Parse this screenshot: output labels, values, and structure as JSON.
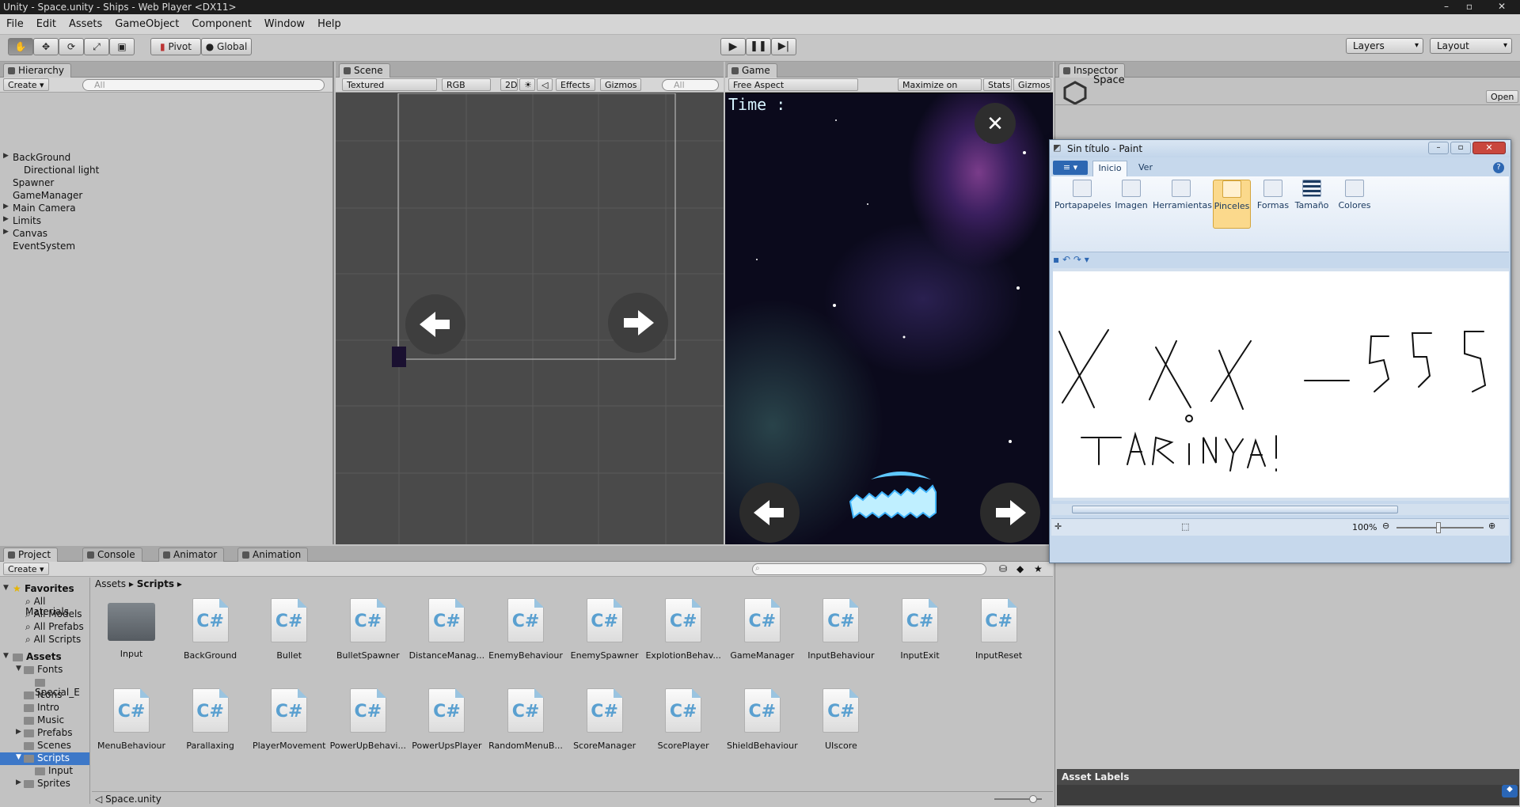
{
  "window": {
    "title": "Unity - Space.unity - Ships - Web Player <DX11>"
  },
  "menu": [
    "File",
    "Edit",
    "Assets",
    "GameObject",
    "Component",
    "Window",
    "Help"
  ],
  "toolbar": {
    "pivot": "Pivot",
    "global": "Global",
    "layers": "Layers",
    "layout": "Layout"
  },
  "hierarchy": {
    "tab": "Hierarchy",
    "create": "Create",
    "search_placeholder": "All",
    "items": [
      "BackGround",
      "Directional light",
      "Spawner",
      "GameManager",
      "Main Camera",
      "Limits",
      "Canvas",
      "EventSystem"
    ]
  },
  "scene": {
    "tab": "Scene",
    "shading": "Textured",
    "render": "RGB",
    "mode2d": "2D",
    "effects": "Effects",
    "gizmos": "Gizmos",
    "search_placeholder": "All"
  },
  "game": {
    "tab": "Game",
    "aspect": "Free Aspect",
    "maximize": "Maximize on Play",
    "stats": "Stats",
    "gizmos": "Gizmos",
    "time_label": "Time :"
  },
  "inspector": {
    "tab": "Inspector",
    "object": "Space",
    "open": "Open",
    "asset_labels": "Asset Labels"
  },
  "project": {
    "tabs": [
      "Project",
      "Console",
      "Animator",
      "Animation"
    ],
    "create": "Create",
    "breadcrumb": [
      "Assets",
      "Scripts"
    ],
    "favorites": {
      "title": "Favorites",
      "items": [
        "All Materials",
        "All Models",
        "All Prefabs",
        "All Scripts"
      ]
    },
    "assets_tree": {
      "title": "Assets",
      "items": [
        "Fonts",
        "Special_E",
        "Icons",
        "Intro",
        "Music",
        "Prefabs",
        "Scenes",
        "Scripts",
        "Input",
        "Sprites"
      ]
    },
    "files_row1": [
      "Input",
      "BackGround",
      "Bullet",
      "BulletSpawner",
      "DistanceManag...",
      "EnemyBehaviour",
      "EnemySpawner",
      "ExplotionBehav...",
      "GameManager",
      "InputBehaviour",
      "InputExit",
      "InputReset"
    ],
    "files_row2": [
      "MenuBehaviour",
      "Parallaxing",
      "PlayerMovement",
      "PowerUpBehavi...",
      "PowerUpsPlayer",
      "RandomMenuB...",
      "ScoreManager",
      "ScorePlayer",
      "ShieldBehaviour",
      "UIscore"
    ],
    "status": "Space.unity"
  },
  "paint": {
    "title": "Sin título - Paint",
    "tabs": [
      "Inicio",
      "Ver"
    ],
    "groups": [
      "Portapapeles",
      "Imagen",
      "Herramientas",
      "Pinceles",
      "Formas",
      "Tamaño",
      "Colores"
    ],
    "zoom": "100%"
  }
}
